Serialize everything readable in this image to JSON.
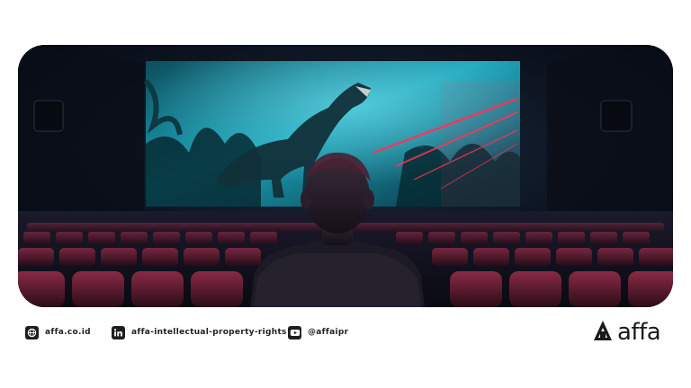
{
  "hero": {
    "icon": "cinema-hero-image",
    "colors": {
      "screen_cyan": "#1aa3b8",
      "laser_red": "#ff3355",
      "seat_red": "#7a2036"
    }
  },
  "footer": {
    "website": {
      "icon": "globe-icon",
      "text": "affa.co.id"
    },
    "linkedin": {
      "icon": "linkedin-icon",
      "text": "affa-intellectual-property-rights"
    },
    "youtube": {
      "icon": "youtube-icon",
      "text": "@affaipr"
    }
  },
  "brand": {
    "icon": "affa-logo-icon",
    "name": "affa"
  }
}
